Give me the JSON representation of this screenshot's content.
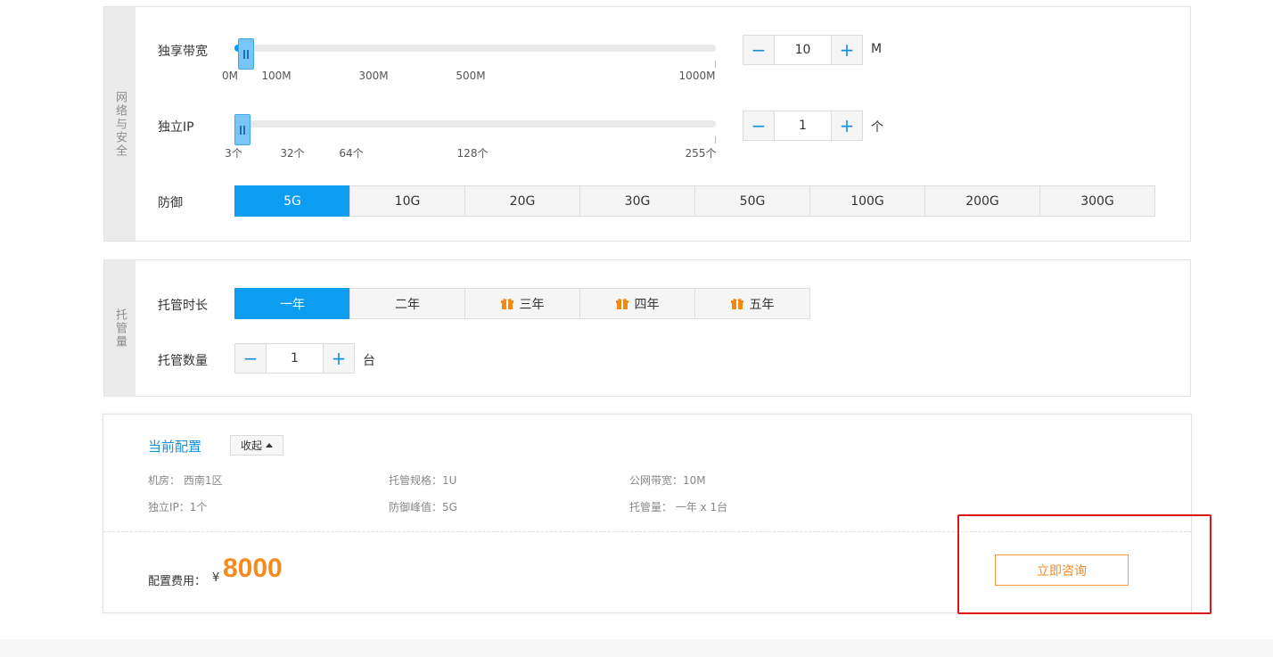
{
  "network": {
    "side_title": "网络与安全",
    "bandwidth": {
      "label": "独享带宽",
      "ticks": [
        "0M",
        "100M",
        "300M",
        "500M",
        "1000M"
      ],
      "value": "10",
      "unit": "M",
      "level": 0.01
    },
    "ip": {
      "label": "独立IP",
      "ticks": [
        "3个",
        "32个",
        "64个",
        "128个",
        "255个"
      ],
      "value": "1",
      "unit": "个",
      "level": 0.0
    },
    "defense": {
      "label": "防御",
      "options": [
        "5G",
        "10G",
        "20G",
        "30G",
        "50G",
        "100G",
        "200G",
        "300G"
      ],
      "selected": "5G"
    }
  },
  "hosting": {
    "side_title": "托管量",
    "duration": {
      "label": "托管时长",
      "options": [
        {
          "label": "一年",
          "gift": false
        },
        {
          "label": "二年",
          "gift": false
        },
        {
          "label": "三年",
          "gift": true
        },
        {
          "label": "四年",
          "gift": true
        },
        {
          "label": "五年",
          "gift": true
        }
      ],
      "selected": "一年"
    },
    "count": {
      "label": "托管数量",
      "value": "1",
      "unit": "台"
    }
  },
  "summary": {
    "title": "当前配置",
    "collapse_label": "收起",
    "specs": [
      "机房： 西南1区",
      "托管规格：1U",
      "公网带宽：10M",
      "独立IP：1个",
      "防御峰值：5G",
      "托管量： 一年 x 1台"
    ],
    "fee_label": "配置费用：",
    "currency": "¥",
    "fee_value": "8000",
    "consult_label": "立即咨询"
  },
  "colors": {
    "accent": "#0d9df0",
    "price": "#f58a1e",
    "highlight": "#e01515"
  },
  "icons": {
    "minus": "−",
    "plus": "+",
    "gift": "gift-icon",
    "caret": "caret-up-icon"
  }
}
